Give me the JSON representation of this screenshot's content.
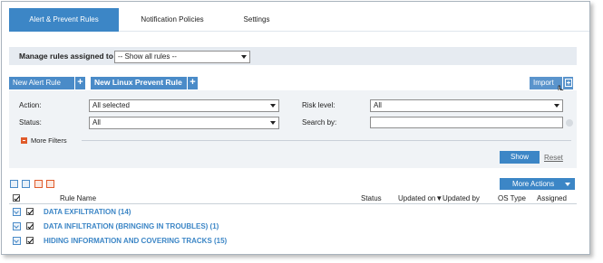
{
  "tabs": [
    {
      "label": "Alert & Prevent Rules",
      "active": true
    },
    {
      "label": "Notification Policies",
      "active": false
    },
    {
      "label": "Settings",
      "active": false
    }
  ],
  "manage": {
    "label": "Manage rules assigned to",
    "selected": "-- Show all rules --"
  },
  "actions": {
    "new_alert_rule": "New Alert Rule",
    "new_linux_prevent_rule": "New Linux Prevent Rule",
    "import": "Import"
  },
  "filters": {
    "action_label": "Action:",
    "action_value": "All selected",
    "status_label": "Status:",
    "status_value": "All",
    "risk_label": "Risk level:",
    "risk_value": "All",
    "search_label": "Search by:",
    "search_value": "",
    "more_filters": "More Filters",
    "show": "Show",
    "reset": "Reset"
  },
  "toolbar": {
    "more_actions": "More Actions"
  },
  "table": {
    "columns": {
      "rule_name": "Rule Name",
      "status": "Status",
      "updated_on": "Updated on▼",
      "updated_by": "Updated by",
      "os_type": "OS Type",
      "assigned": "Assigned"
    },
    "rows": [
      {
        "name": "DATA EXFILTRATION (14)"
      },
      {
        "name": "DATA INFILTRATION (BRINGING IN TROUBLES) (1)"
      },
      {
        "name": "HIDING INFORMATION AND COVERING TRACKS (15)"
      }
    ]
  },
  "colors": {
    "accent": "#3c86c6",
    "orange": "#e05b2b"
  }
}
